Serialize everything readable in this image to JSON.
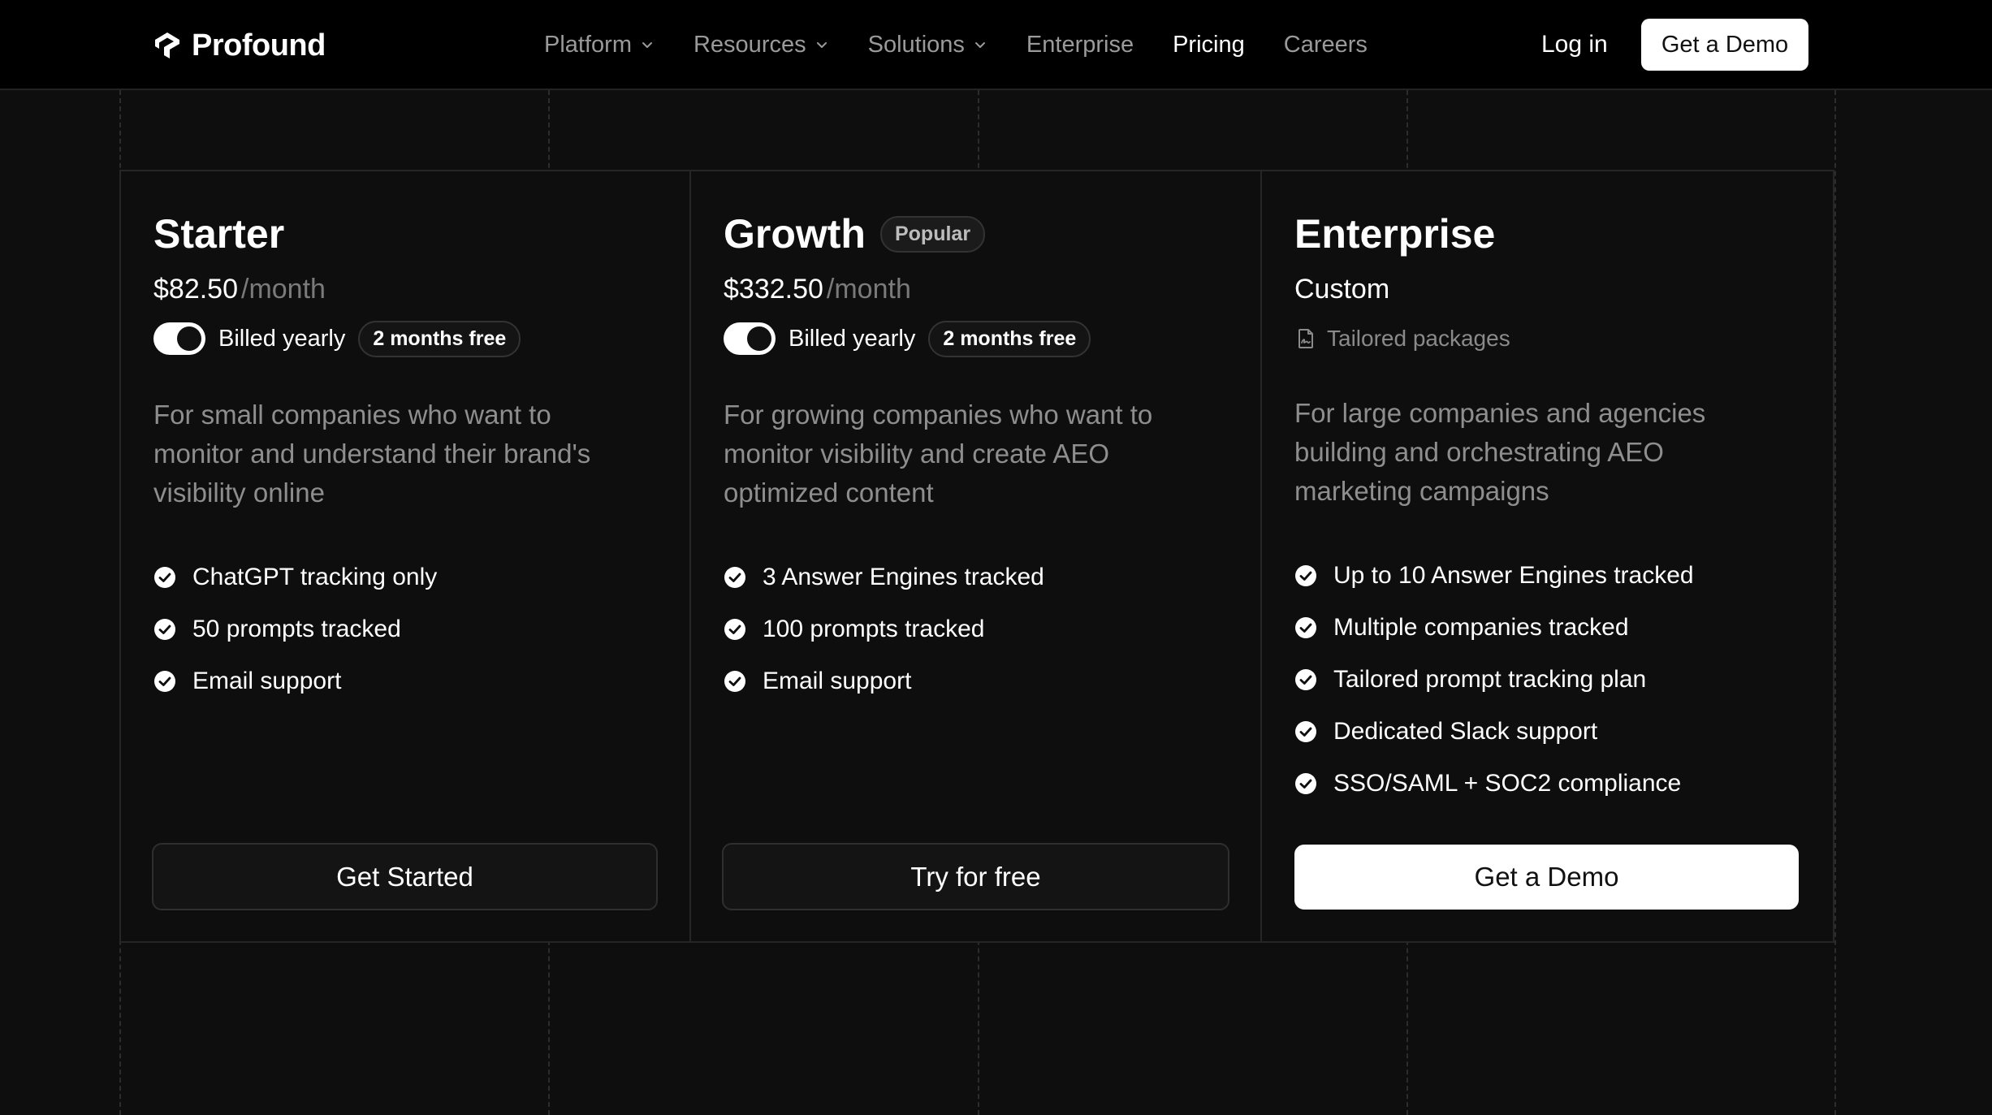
{
  "nav": {
    "brand": "Profound",
    "links": [
      {
        "label": "Platform",
        "dropdown": true,
        "active": false
      },
      {
        "label": "Resources",
        "dropdown": true,
        "active": false
      },
      {
        "label": "Solutions",
        "dropdown": true,
        "active": false
      },
      {
        "label": "Enterprise",
        "dropdown": false,
        "active": false
      },
      {
        "label": "Pricing",
        "dropdown": false,
        "active": true
      },
      {
        "label": "Careers",
        "dropdown": false,
        "active": false
      }
    ],
    "login_label": "Log in",
    "demo_label": "Get a Demo"
  },
  "plans": [
    {
      "name": "Starter",
      "price": "$82.50",
      "period": "/month",
      "billing_label": "Billed yearly",
      "billing_toggle_on": true,
      "free_badge": "2 months free",
      "description": "For small companies who want to monitor and understand their brand's visibility online",
      "features": [
        "ChatGPT tracking only",
        "50 prompts tracked",
        "Email support"
      ],
      "cta": "Get Started"
    },
    {
      "name": "Growth",
      "badge": "Popular",
      "price": "$332.50",
      "period": "/month",
      "billing_label": "Billed yearly",
      "billing_toggle_on": true,
      "free_badge": "2 months free",
      "description": "For growing companies who want to monitor visibility and create AEO optimized content",
      "features": [
        "3 Answer Engines tracked",
        "100 prompts tracked",
        "Email support"
      ],
      "cta": "Try for free"
    },
    {
      "name": "Enterprise",
      "price_label": "Custom",
      "tailored_label": "Tailored packages",
      "description": "For large companies and agencies building and orchestrating AEO marketing campaigns",
      "features": [
        "Up to 10 Answer Engines tracked",
        "Multiple companies tracked",
        "Tailored prompt tracking plan",
        "Dedicated Slack support",
        "SSO/SAML + SOC2 compliance"
      ],
      "cta": "Get a Demo"
    }
  ],
  "icons": {
    "logo": "profound-logo-icon",
    "dropdown": "chevron-down-icon",
    "feature": "check-circle-icon",
    "tailored": "document-signature-icon"
  },
  "colors": {
    "background": "#0e0e0e",
    "nav_background": "#000000",
    "text": "#ffffff",
    "muted_text": "#8e8e8e",
    "border": "#262626",
    "primary_button": "#ffffff"
  }
}
